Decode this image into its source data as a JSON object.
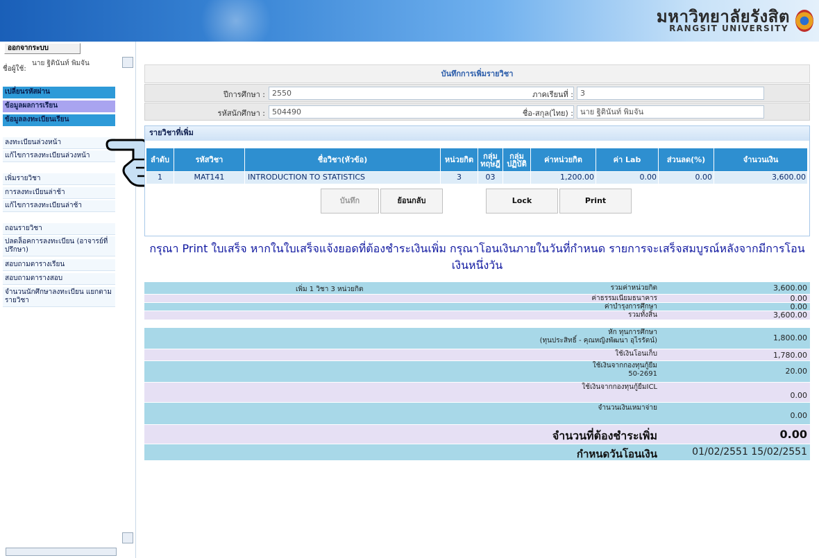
{
  "header": {
    "logo_th": "มหาวิทยาลัยรังสิต",
    "logo_en": "RANGSIT UNIVERSITY"
  },
  "nav": {
    "logout": "ออกจากระบบ",
    "user_label": "ชื่อผู้ใช้:",
    "user_name": "นาย ฐิตินันท์ พิมจัน",
    "heads": [
      "เปลี่ยนรหัสผ่าน",
      "ข้อมูลผลการเรียน",
      "ข้อมูลลงทะเบียนเรียน"
    ],
    "items": [
      "ลงทะเบียนล่วงหน้า",
      "แก้ไขการลงทะเบียนล่วงหน้า",
      "เพิ่มรายวิชา",
      "การลงทะเบียนล่าช้า",
      "แก้ไขการลงทะเบียนล่าช้า",
      "ถอนรายวิชา",
      "ปลดล็อคการลงทะเบียน (อาจารย์ที่ปรึกษา)",
      "สอบถามตารางเรียน",
      "สอบถามตารางสอบ",
      "จำนวนนักศึกษาลงทะเบียน แยกตามรายวิชา"
    ]
  },
  "form": {
    "title": "บันทึกการเพิ่มรายวิชา",
    "year_label": "ปีการศึกษา :",
    "year_value": "2550",
    "term_label": "ภาคเรียนที่ :",
    "term_value": "3",
    "id_label": "รหัสนักศึกษา :",
    "id_value": "504490",
    "name_label": "ชื่อ-สกุล(ไทย) :",
    "name_value": "นาย ฐิตินันท์ พิมจัน"
  },
  "courses": {
    "title": "รายวิชาที่เพิ่ม",
    "headers": [
      "ลำดับ",
      "รหัสวิชา",
      "ชื่อวิชา(หัวข้อ)",
      "หน่วยกิต",
      "กลุ่ม ทฤษฎี",
      "กลุ่ม ปฏิบัติ",
      "ค่าหน่วยกิต",
      "ค่า Lab",
      "ส่วนลด(%)",
      "จำนวนเงิน"
    ],
    "rows": [
      [
        "1",
        "MAT141",
        "INTRODUCTION TO STATISTICS",
        "3",
        "03",
        "",
        "1,200.00",
        "0.00",
        "0.00",
        "3,600.00"
      ]
    ]
  },
  "buttons": {
    "save": "บันทึก",
    "back": "ย้อนกลับ",
    "lock": "Lock",
    "print": "Print"
  },
  "notice": "กรุณา Print ใบเสร็จ หากในใบเสร็จแจ้งยอดที่ต้องชำระเงินเพิ่ม กรุณาโอนเงินภายในวันที่กำหนด รายการจะเสร็จสมบูรณ์หลังจากมีการโอนเงินหนึ่งวัน",
  "summary": {
    "added": "เพิ่ม 1 วิชา 3 หน่วยกิต",
    "rows": [
      {
        "label": "รวมค่าหน่วยกิต",
        "value": "3,600.00"
      },
      {
        "label": "ค่าธรรมเนียมธนาคาร",
        "value": "0.00"
      },
      {
        "label": "ค่าบำรุงการศึกษา",
        "value": "0.00"
      },
      {
        "label": "รวมทั้งสิ้น",
        "value": "3,600.00"
      },
      {
        "label": "หัก ทุนการศึกษา",
        "label2": "(ทุนประสิทธิ์ - คุณหญิงพัฒนา อุไรรัตน์)",
        "value": "1,800.00"
      },
      {
        "label": "ใช้เงินโอนเก็บ",
        "value": "1,780.00"
      },
      {
        "label": "ใช้เงินจากกองทุนกู้ยืม",
        "label2": "50-2691",
        "value": "20.00"
      },
      {
        "label": "ใช้เงินจากกองทุนกู้ยืมICL",
        "value": "0.00"
      },
      {
        "label": "จำนวนเงินเหมาจ่าย",
        "value": "0.00"
      }
    ],
    "due_label": "จำนวนที่ต้องชำระเพิ่ม",
    "due_value": "0.00",
    "transfer_label": "กำหนดวันโอนเงิน",
    "transfer_value": "01/02/2551 15/02/2551"
  }
}
